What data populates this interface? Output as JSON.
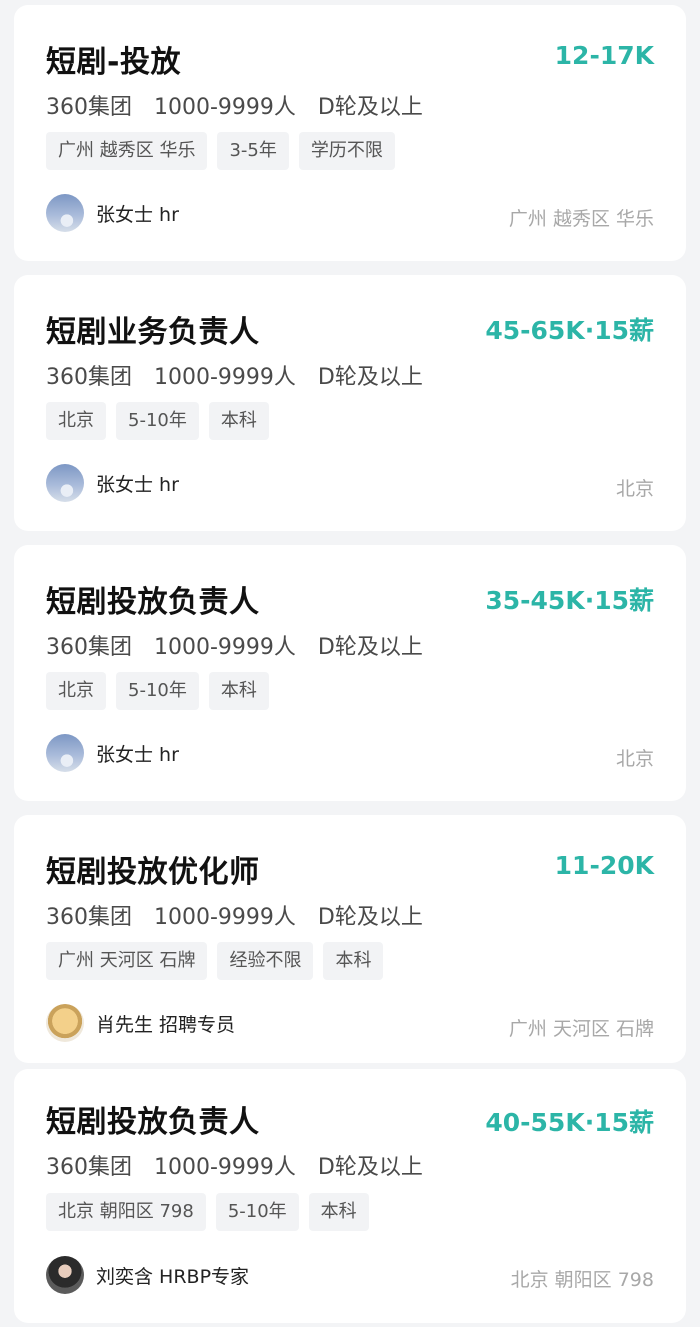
{
  "jobs": [
    {
      "title": "短剧-投放",
      "salary": "12-17K",
      "company": "360集团",
      "size": "1000-9999人",
      "stage": "D轮及以上",
      "tags": [
        "广州 越秀区 华乐",
        "3-5年",
        "学历不限"
      ],
      "recruiter": "张女士 hr",
      "location": "广州 越秀区 华乐"
    },
    {
      "title": "短剧业务负责人",
      "salary": "45-65K·15薪",
      "company": "360集团",
      "size": "1000-9999人",
      "stage": "D轮及以上",
      "tags": [
        "北京",
        "5-10年",
        "本科"
      ],
      "recruiter": "张女士 hr",
      "location": "北京"
    },
    {
      "title": "短剧投放负责人",
      "salary": "35-45K·15薪",
      "company": "360集团",
      "size": "1000-9999人",
      "stage": "D轮及以上",
      "tags": [
        "北京",
        "5-10年",
        "本科"
      ],
      "recruiter": "张女士 hr",
      "location": "北京"
    },
    {
      "title": "短剧投放优化师",
      "salary": "11-20K",
      "company": "360集团",
      "size": "1000-9999人",
      "stage": "D轮及以上",
      "tags": [
        "广州 天河区 石牌",
        "经验不限",
        "本科"
      ],
      "recruiter": "肖先生 招聘专员",
      "location": "广州 天河区 石牌"
    },
    {
      "title": "短剧投放负责人",
      "salary": "40-55K·15薪",
      "company": "360集团",
      "size": "1000-9999人",
      "stage": "D轮及以上",
      "tags": [
        "北京 朝阳区 798",
        "5-10年",
        "本科"
      ],
      "recruiter": "刘奕含 HRBP专家",
      "location": "北京 朝阳区 798"
    }
  ]
}
